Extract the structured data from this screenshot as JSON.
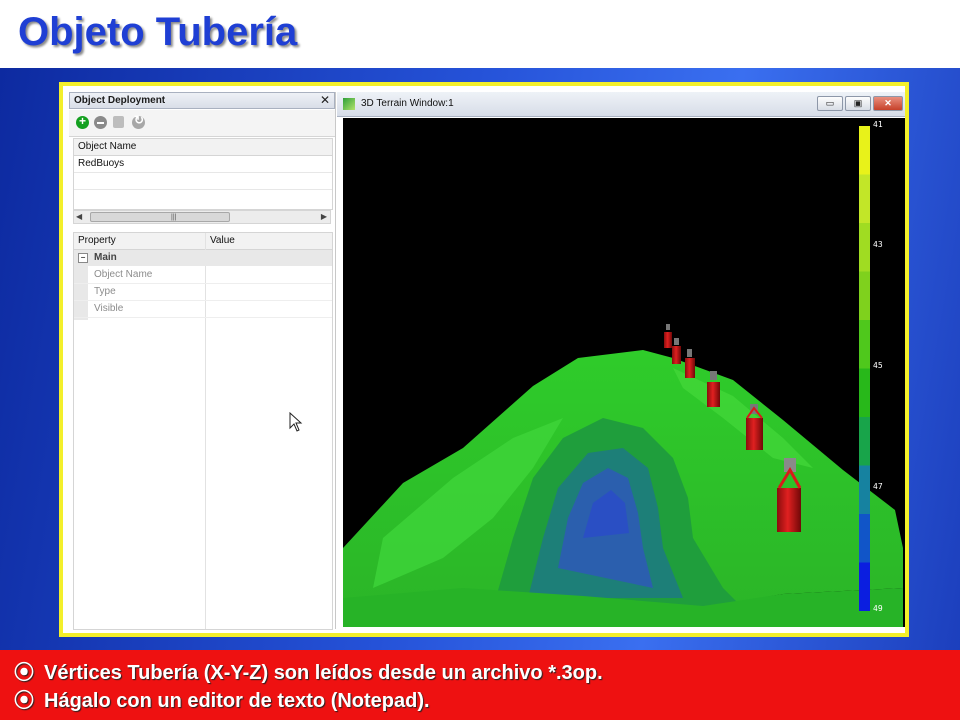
{
  "slide": {
    "title": "Objeto Tubería",
    "bullets": [
      "Vértices Tubería (X-Y-Z) son leídos desde un archivo *.3op.",
      "Hágalo con un editor de texto (Notepad)."
    ],
    "bullet_glyph": "⦿"
  },
  "panel": {
    "title": "Object Deployment",
    "close_glyph": "✕",
    "column_header": "Object Name",
    "objects": [
      "RedBuoys"
    ],
    "property_grid": {
      "header_property": "Property",
      "header_value": "Value",
      "category": "Main",
      "category_toggle": "−",
      "rows": [
        "Object Name",
        "Type",
        "Visible"
      ]
    }
  },
  "window": {
    "title": "3D Terrain Window:1",
    "min_glyph": "▭",
    "max_glyph": "▣",
    "close_glyph": "✕"
  },
  "colorbar": {
    "labels": [
      "41",
      "43",
      "45",
      "47",
      "49"
    ],
    "colors": [
      "#e8f21a",
      "#c2e628",
      "#a0dc22",
      "#7fd11d",
      "#4fc81c",
      "#28b81a",
      "#18a44a",
      "#1682a0",
      "#1155c8",
      "#0b1ee0"
    ]
  },
  "colors": {
    "title": "#1f3fd4",
    "text_band": "#ee1111",
    "frame": "#f3ef2a",
    "buoy": "#d81a1a"
  }
}
